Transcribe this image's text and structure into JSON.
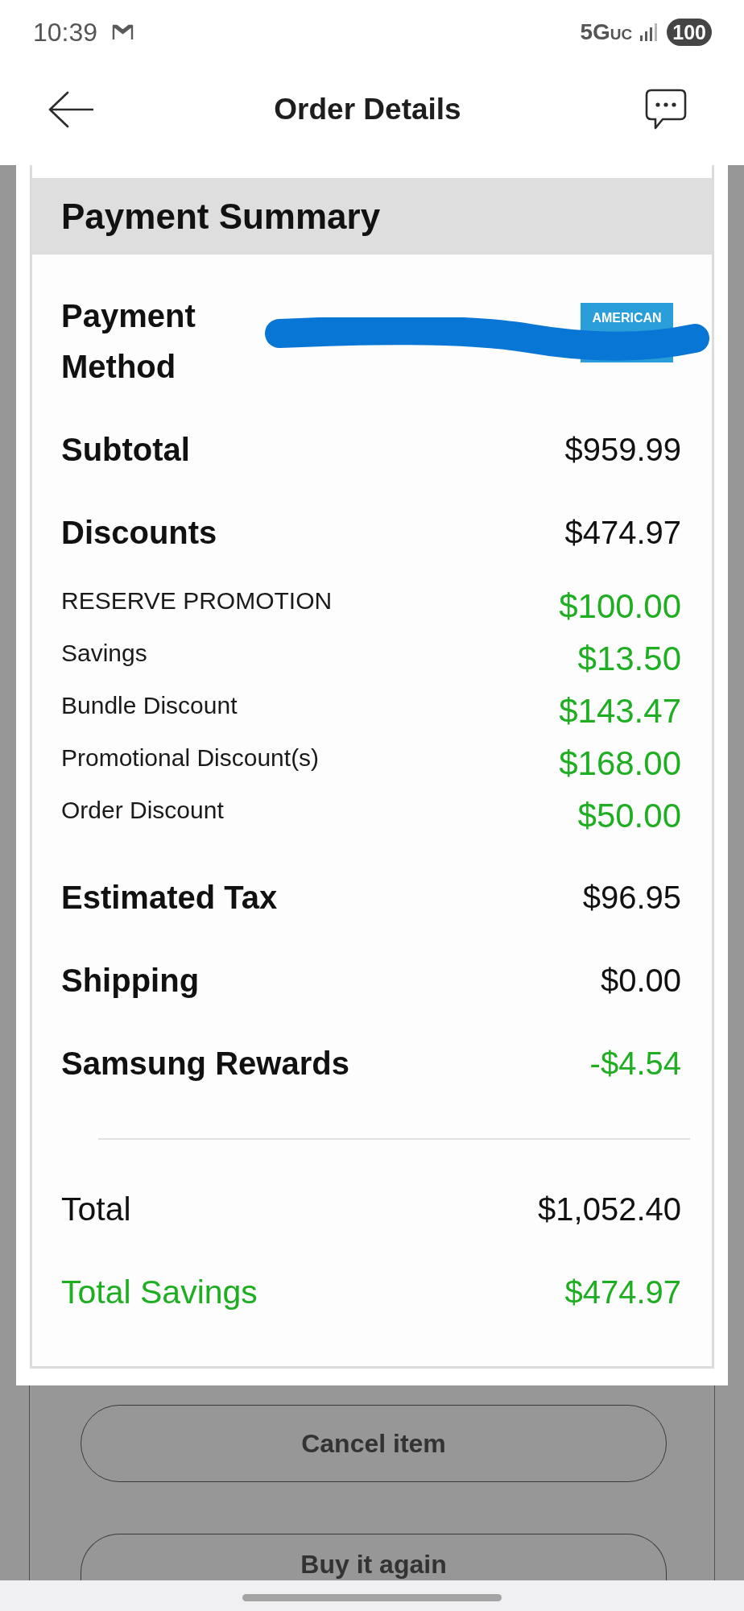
{
  "status_bar": {
    "time": "10:39",
    "network": "5G$_{UC}$",
    "battery": "100"
  },
  "header": {
    "title": "Order Details"
  },
  "payment_summary": {
    "title": "Payment Summary",
    "payment_method": {
      "label": "Payment Method",
      "card_brand_text": "AMERICAN",
      "redacted": true
    },
    "rows": [
      {
        "kind": "amount",
        "label": "Subtotal",
        "value": "$959.99"
      },
      {
        "kind": "amount",
        "label": "Discounts",
        "value": "$474.97"
      },
      {
        "kind": "discount",
        "label": "RESERVE PROMOTION",
        "value": "$100.00"
      },
      {
        "kind": "discount",
        "label": "Savings",
        "value": "$13.50"
      },
      {
        "kind": "discount",
        "label": "Bundle Discount",
        "value": "$143.47"
      },
      {
        "kind": "discount",
        "label": "Promotional Discount(s)",
        "value": "$168.00"
      },
      {
        "kind": "discount",
        "label": "Order Discount",
        "value": "$50.00"
      },
      {
        "kind": "amount",
        "label": "Estimated Tax",
        "value": "$96.95"
      },
      {
        "kind": "amount",
        "label": "Shipping",
        "value": "$0.00"
      },
      {
        "kind": "credit",
        "label": "Samsung Rewards",
        "value": "-$4.54"
      }
    ],
    "totals": [
      {
        "kind": "total",
        "label": "Total",
        "value": "$1,052.40"
      },
      {
        "kind": "savings",
        "label": "Total Savings",
        "value": "$474.97"
      }
    ]
  },
  "actions": [
    {
      "label": "Cancel item"
    },
    {
      "label": "Buy it again"
    }
  ]
}
